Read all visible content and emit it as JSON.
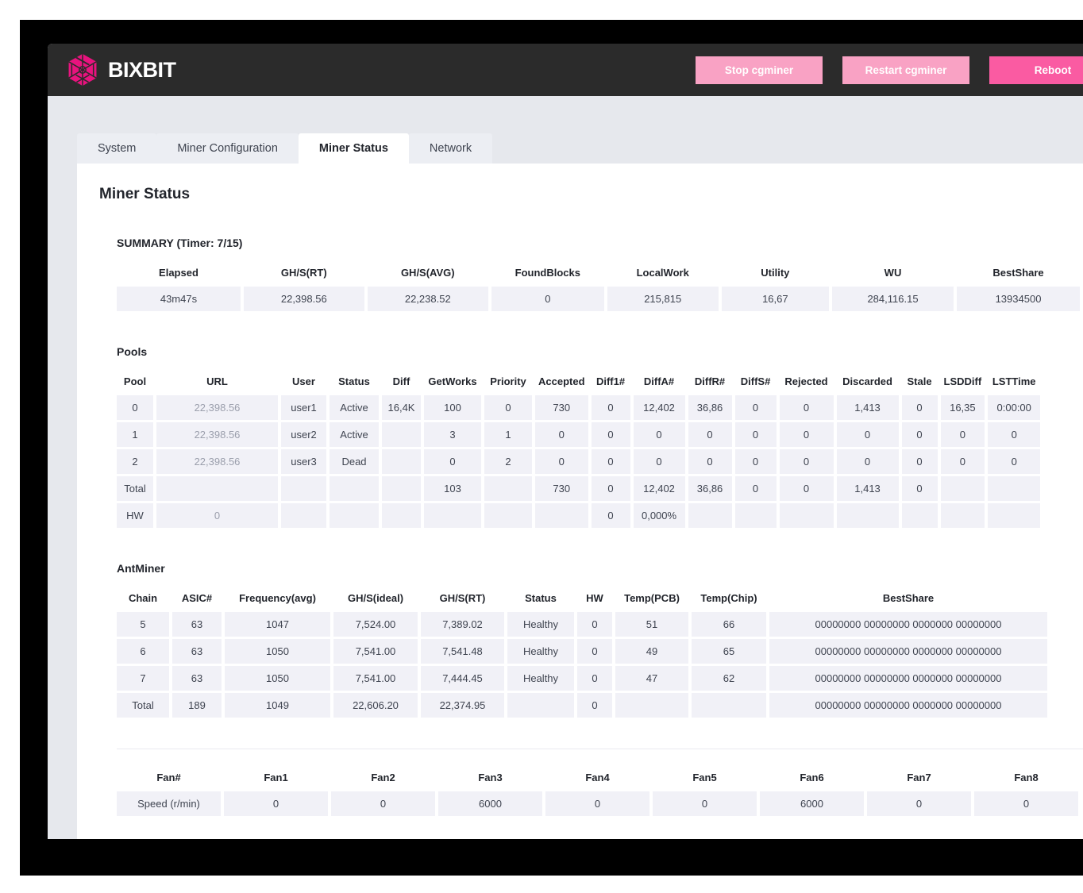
{
  "brand": {
    "name": "BIXBIT",
    "logo_icon": "hexagon-aperture-icon",
    "logo_color": "#e8137e"
  },
  "topbar": {
    "buttons": [
      {
        "label": "Stop cgminer",
        "color": "#f9a2c4"
      },
      {
        "label": "Restart cgminer",
        "color": "#f9a2c4"
      },
      {
        "label": "Reboot",
        "color": "#fa5ba2"
      }
    ]
  },
  "tabs": [
    {
      "label": "System",
      "active": false
    },
    {
      "label": "Miner Configuration",
      "active": false
    },
    {
      "label": "Miner Status",
      "active": true
    },
    {
      "label": "Network",
      "active": false
    }
  ],
  "page": {
    "title": "Miner Status"
  },
  "summary": {
    "label": "SUMMARY (Timer: 7/15)",
    "headers": [
      "Elapsed",
      "GH/S(RT)",
      "GH/S(AVG)",
      "FoundBlocks",
      "LocalWork",
      "Utility",
      "WU",
      "BestShare"
    ],
    "values": [
      "43m47s",
      "22,398.56",
      "22,238.52",
      "0",
      "215,815",
      "16,67",
      "284,116.15",
      "13934500"
    ]
  },
  "pools": {
    "label": "Pools",
    "headers": [
      "Pool",
      "URL",
      "User",
      "Status",
      "Diff",
      "GetWorks",
      "Priority",
      "Accepted",
      "Diff1#",
      "DiffA#",
      "DiffR#",
      "DiffS#",
      "Rejected",
      "Discarded",
      "Stale",
      "LSDDiff",
      "LSTTime"
    ],
    "rows": [
      [
        "0",
        "22,398.56",
        "user1",
        "Active",
        "16,4K",
        "100",
        "0",
        "730",
        "0",
        "12,402",
        "36,86",
        "0",
        "0",
        "1,413",
        "0",
        "16,35",
        "0:00:00"
      ],
      [
        "1",
        "22,398.56",
        "user2",
        "Active",
        "",
        "3",
        "1",
        "0",
        "0",
        "0",
        "0",
        "0",
        "0",
        "0",
        "0",
        "0",
        "0"
      ],
      [
        "2",
        "22,398.56",
        "user3",
        "Dead",
        "",
        "0",
        "2",
        "0",
        "0",
        "0",
        "0",
        "0",
        "0",
        "0",
        "0",
        "0",
        "0"
      ],
      [
        "Total",
        "",
        "",
        "",
        "",
        "103",
        "",
        "730",
        "0",
        "12,402",
        "36,86",
        "0",
        "0",
        "1,413",
        "0",
        "",
        ""
      ],
      [
        "HW",
        "0",
        "",
        "",
        "",
        "",
        "",
        "",
        "0",
        "0,000%",
        "",
        "",
        "",
        "",
        "",
        "",
        ""
      ]
    ]
  },
  "antminer": {
    "label": "AntMiner",
    "headers": [
      "Chain",
      "ASIC#",
      "Frequency(avg)",
      "GH/S(ideal)",
      "GH/S(RT)",
      "Status",
      "HW",
      "Temp(PCB)",
      "Temp(Chip)",
      "BestShare"
    ],
    "rows": [
      [
        "5",
        "63",
        "1047",
        "7,524.00",
        "7,389.02",
        "Healthy",
        "0",
        "51",
        "66",
        "00000000 00000000 0000000 00000000"
      ],
      [
        "6",
        "63",
        "1050",
        "7,541.00",
        "7,541.48",
        "Healthy",
        "0",
        "49",
        "65",
        "00000000 00000000 0000000 00000000"
      ],
      [
        "7",
        "63",
        "1050",
        "7,541.00",
        "7,444.45",
        "Healthy",
        "0",
        "47",
        "62",
        "00000000 00000000 0000000 00000000"
      ],
      [
        "Total",
        "189",
        "1049",
        "22,606.20",
        "22,374.95",
        "",
        "0",
        "",
        "",
        "00000000 00000000 0000000 00000000"
      ]
    ]
  },
  "fans": {
    "headers": [
      "Fan#",
      "Fan1",
      "Fan2",
      "Fan3",
      "Fan4",
      "Fan5",
      "Fan6",
      "Fan7",
      "Fan8"
    ],
    "row": [
      "Speed (r/min)",
      "0",
      "0",
      "6000",
      "0",
      "0",
      "6000",
      "0",
      "0"
    ]
  }
}
